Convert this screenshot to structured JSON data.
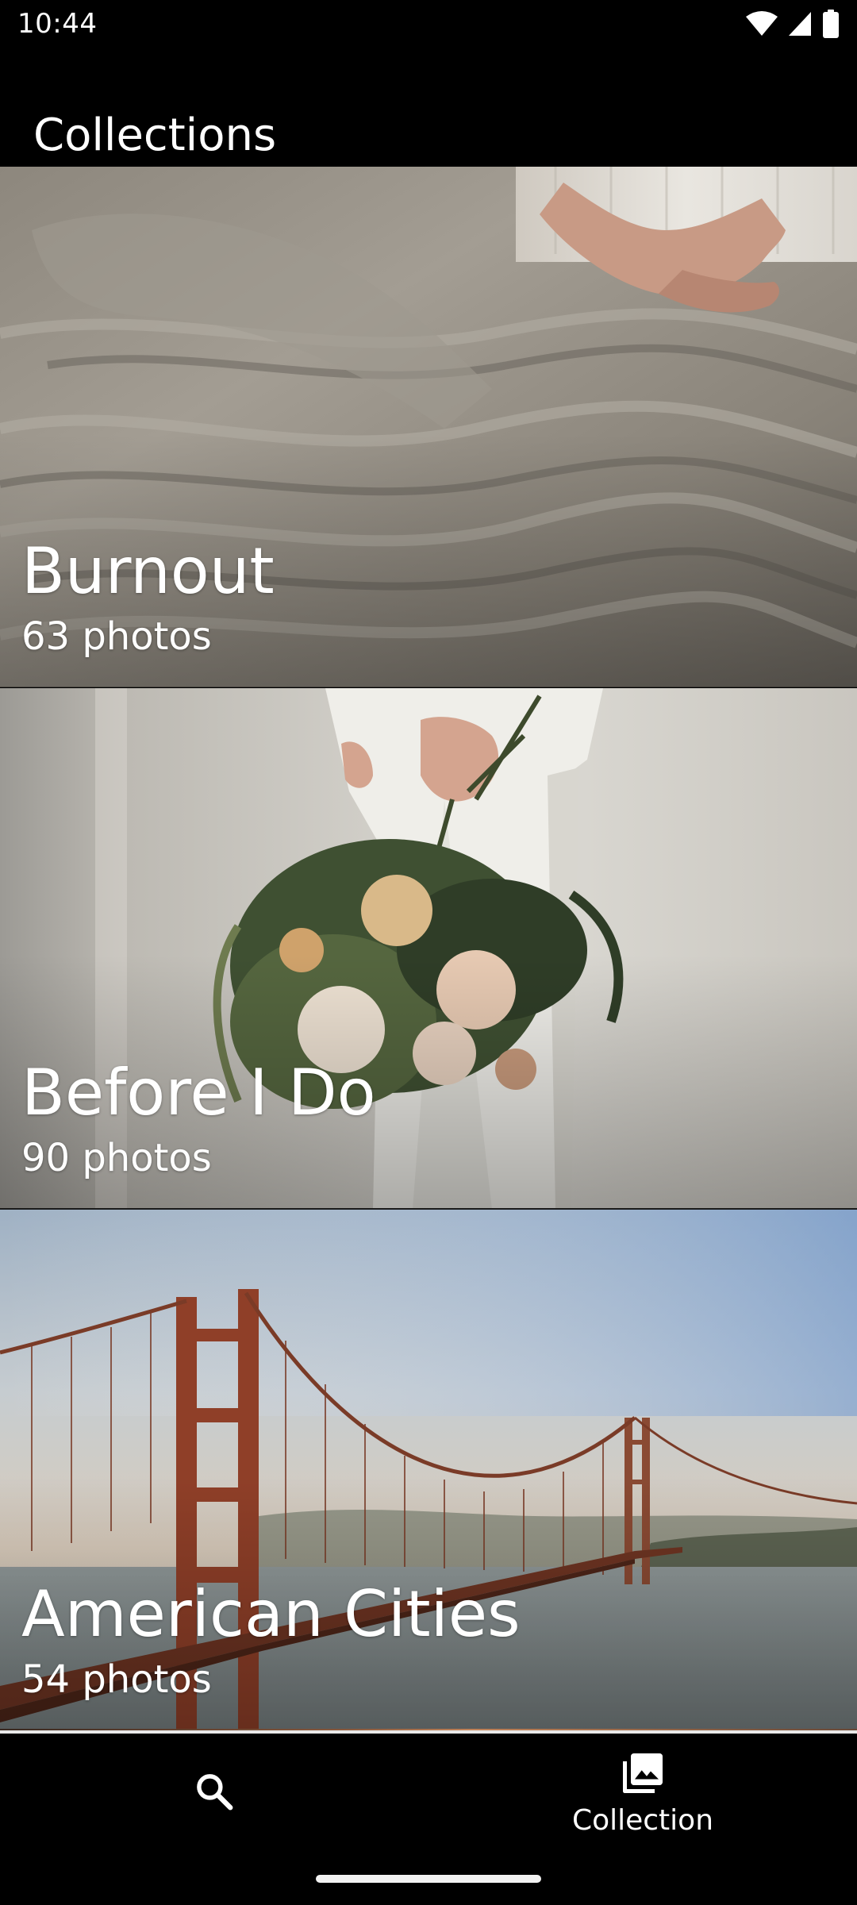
{
  "status_bar": {
    "time": "10:44",
    "icons": [
      "wifi-icon",
      "cellular-signal-icon",
      "battery-icon"
    ]
  },
  "app_bar": {
    "title": "Collections"
  },
  "collections": [
    {
      "title": "Burnout",
      "count": "63 photos",
      "image": "crumpled-bedsheet-photo"
    },
    {
      "title": "Before I Do",
      "count": "90 photos",
      "image": "bridal-bouquet-photo"
    },
    {
      "title": "American Cities",
      "count": "54 photos",
      "image": "golden-gate-bridge-photo"
    }
  ],
  "bottom_nav": {
    "items": [
      {
        "icon": "search-icon",
        "label": ""
      },
      {
        "icon": "photo-library-icon",
        "label": "Collection",
        "selected": true
      }
    ]
  },
  "colors": {
    "background": "#000000",
    "text": "#FFFFFF"
  }
}
